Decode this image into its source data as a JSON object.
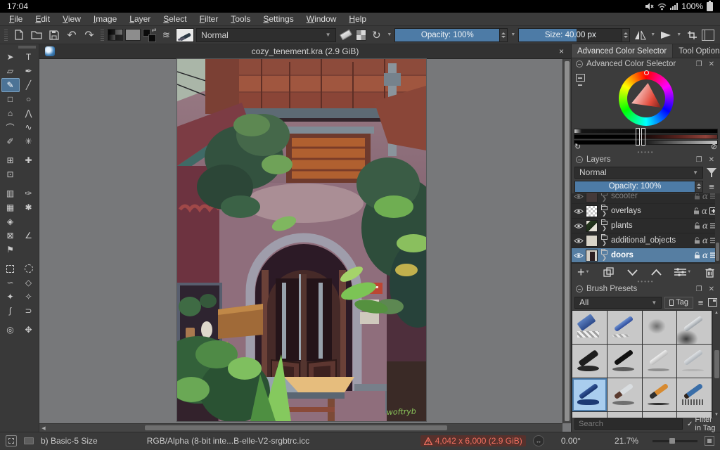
{
  "status_bar": {
    "time": "17:04",
    "battery": "100%"
  },
  "menubar": {
    "items": [
      "File",
      "Edit",
      "View",
      "Image",
      "Layer",
      "Select",
      "Filter",
      "Tools",
      "Settings",
      "Window",
      "Help"
    ]
  },
  "toolbar": {
    "blend_mode": "Normal",
    "opacity": "Opacity: 100%",
    "size": "Size: 40.00 px"
  },
  "toolbox": {
    "tools": [
      "➤",
      "T",
      "▱",
      "✒",
      "✎",
      "╱",
      "□",
      "○",
      "⌂",
      "⋀",
      "⌒",
      "∿",
      "✐",
      "✳",
      "⊞",
      "✚",
      "⊡",
      "",
      "▥",
      "✑",
      "▦",
      "✱",
      "◈",
      "",
      "⊠",
      "∠",
      "⚑",
      "",
      "",
      "",
      "∽",
      "◇",
      "✦",
      "✧",
      "∫",
      "⊃",
      "◎",
      "✥"
    ]
  },
  "document": {
    "tab_title": "cozy_tenement.kra (2.9 GiB)",
    "close": "×",
    "signature": "woftryb"
  },
  "right_panel": {
    "tabs": [
      "Advanced Color Selector",
      "Tool Options"
    ],
    "color_selector": {
      "title": "Advanced Color Selector"
    },
    "layers": {
      "title": "Layers",
      "blend_mode": "Normal",
      "opacity": "Opacity: 100%",
      "items": [
        {
          "name": "scooter"
        },
        {
          "name": "overlays"
        },
        {
          "name": "plants"
        },
        {
          "name": "additional_objects"
        },
        {
          "name": "doors"
        }
      ],
      "selected": "doors"
    },
    "brush_presets": {
      "title": "Brush Presets",
      "filter": "All",
      "tag_button": "Tag",
      "search_placeholder": "Search",
      "filter_in_tag": "Filter in Tag"
    }
  },
  "statusbar": {
    "brush": "b) Basic-5 Size",
    "profile": "RGB/Alpha (8-bit inte...B-elle-V2-srgbtrc.icc",
    "dimensions": "4,042 x 6,000 (2.9 GiB)",
    "rotation": "0.00°",
    "zoom": "21.7%"
  },
  "colors": {
    "accent_blue": "#4d7ba6",
    "selection_blue": "#567ea2",
    "warning_red": "#ef6f5f",
    "canvas_gray": "#77787a"
  }
}
